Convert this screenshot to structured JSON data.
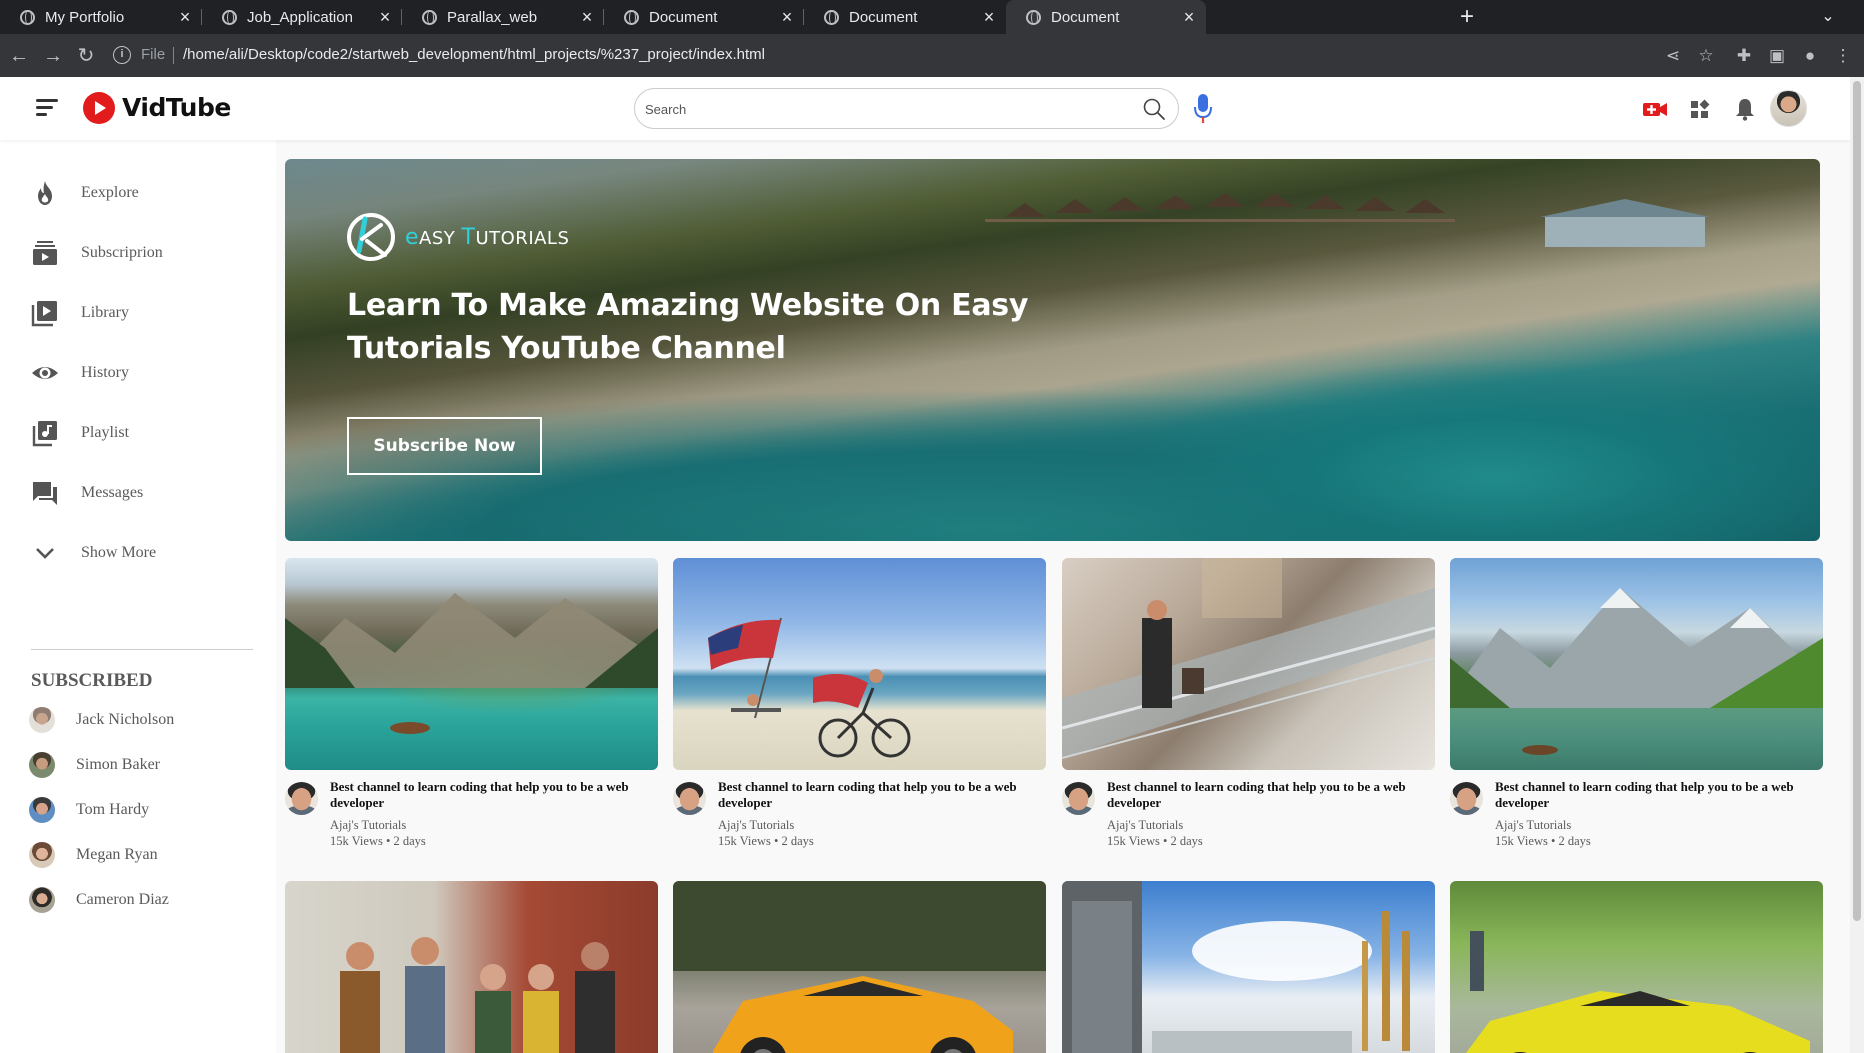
{
  "browser": {
    "tabs": [
      {
        "title": "My Portfolio"
      },
      {
        "title": "Job_Application"
      },
      {
        "title": "Parallax_web"
      },
      {
        "title": "Document"
      },
      {
        "title": "Document"
      },
      {
        "title": "Document"
      }
    ],
    "active_tab_index": 5,
    "url_scheme": "File",
    "url": "/home/ali/Desktop/code2/startweb_development/html_projects/%237_project/index.html"
  },
  "header": {
    "logo_text": "VidTube",
    "search_placeholder": "Search",
    "brand_red": "#e21c1c"
  },
  "sidebar": {
    "links": [
      {
        "label": "Eexplore",
        "icon": "flame-icon"
      },
      {
        "label": "Subscriprion",
        "icon": "subscriptions-icon"
      },
      {
        "label": "Library",
        "icon": "library-icon"
      },
      {
        "label": "History",
        "icon": "eye-icon"
      },
      {
        "label": "Playlist",
        "icon": "playlist-icon"
      },
      {
        "label": "Messages",
        "icon": "messages-icon"
      },
      {
        "label": "Show More",
        "icon": "chevron-down-icon"
      }
    ],
    "subscribed_heading": "SUBSCRIBED",
    "subscriptions": [
      {
        "name": "Jack Nicholson"
      },
      {
        "name": "Simon Baker"
      },
      {
        "name": "Tom Hardy"
      },
      {
        "name": "Megan Ryan"
      },
      {
        "name": "Cameron Diaz"
      }
    ]
  },
  "banner": {
    "brand_e": "e",
    "brand_rest_a": "ASY ",
    "brand_t": "T",
    "brand_rest_b": "UTORIALS",
    "heading": "Learn To Make Amazing Website On Easy Tutorials YouTube Channel",
    "button_label": "Subscribe Now",
    "accent": "#2fd0d9"
  },
  "videos": [
    {
      "title": "Best channel to learn coding that help you to be a web developer",
      "channel": "Ajaj's Tutorials",
      "meta": "15k Views • 2 days",
      "scene": "lake-boat"
    },
    {
      "title": "Best channel to learn coding that help you to be a web developer",
      "channel": "Ajaj's Tutorials",
      "meta": "15k Views • 2 days",
      "scene": "beach-flag-bike"
    },
    {
      "title": "Best channel to learn coding that help you to be a web developer",
      "channel": "Ajaj's Tutorials",
      "meta": "15k Views • 2 days",
      "scene": "mall-escalator"
    },
    {
      "title": "Best channel to learn coding that help you to be a web developer",
      "channel": "Ajaj's Tutorials",
      "meta": "15k Views • 2 days",
      "scene": "mountain-lake"
    },
    {
      "title": "",
      "channel": "",
      "meta": "",
      "scene": "friends-street"
    },
    {
      "title": "",
      "channel": "",
      "meta": "",
      "scene": "orange-sports-car"
    },
    {
      "title": "",
      "channel": "",
      "meta": "",
      "scene": "modern-buildings"
    },
    {
      "title": "",
      "channel": "",
      "meta": "",
      "scene": "yellow-sports-car"
    }
  ]
}
